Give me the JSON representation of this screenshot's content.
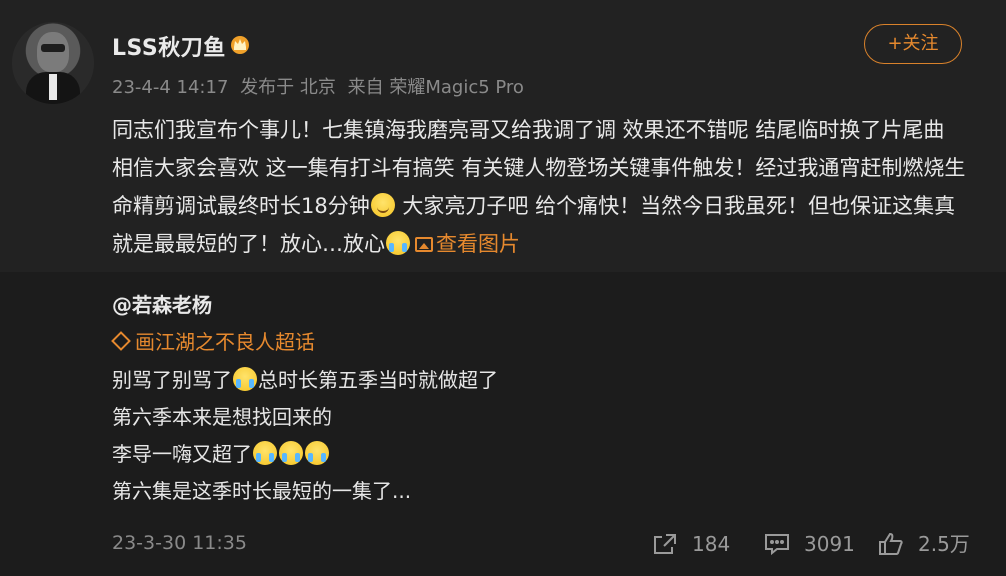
{
  "post": {
    "username": "LSS秋刀鱼",
    "meta": {
      "date": "23-4-4 14:17",
      "location": "发布于 北京",
      "source": "来自 荣耀Magic5 Pro"
    },
    "follow_label": "+关注",
    "text_part1": "同志们我宣布个事儿！七集镇海我磨亮哥又给我调了调 效果还不错呢 结尾临时换了片尾曲 相信大家会喜欢 这一集有打斗有搞笑 有关键人物登场关键事件触发！经过我通宵赶制燃烧生命精剪调试最终时长18分钟",
    "text_part2": " 大家亮刀子吧 给个痛快！当然今日我虽死！但也保证这集真就是最最短的了！放心…放心",
    "view_pictures": "查看图片"
  },
  "repost": {
    "author": "@若森老杨",
    "topic": "画江湖之不良人超话",
    "line1": "别骂了别骂了",
    "line1_rest": "总时长第五季当时就做超了",
    "line2": "第六季本来是想找回来的",
    "line3": "李导一嗨又超了",
    "line4": "第六集是这季时长最短的一集了...",
    "date": "23-3-30 11:35"
  },
  "actions": {
    "share_count": "184",
    "comment_count": "3091",
    "like_count": "2.5万"
  },
  "icons": [
    "crown-icon",
    "share-icon",
    "comment-icon",
    "like-icon",
    "picture-icon",
    "diamond-icon"
  ],
  "colors": {
    "accent": "#e6892e",
    "background": "#1c1c1c",
    "post_background": "#222222"
  }
}
